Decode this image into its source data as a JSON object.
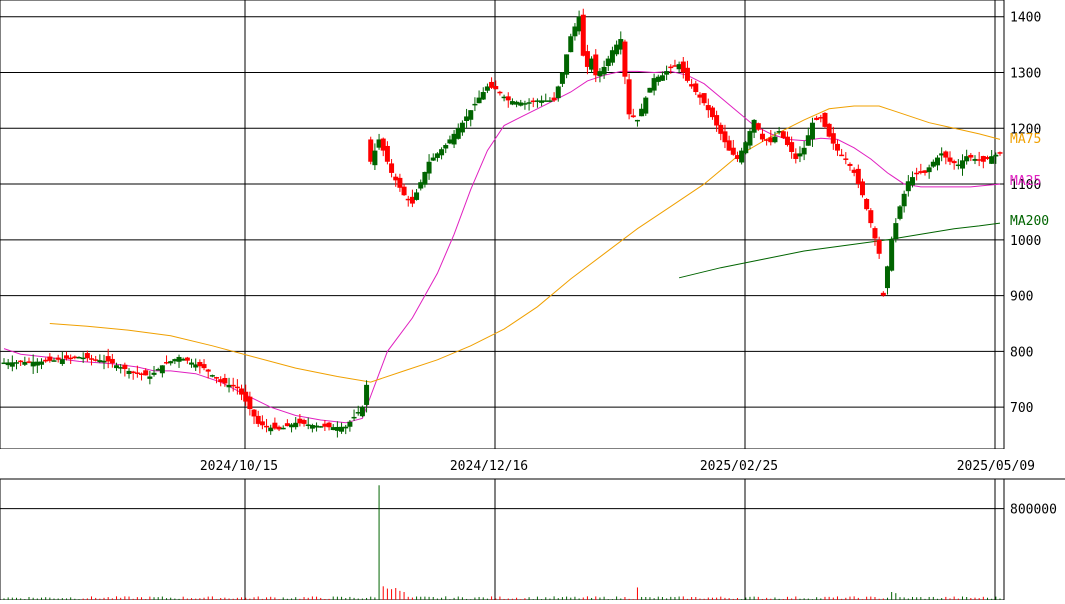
{
  "chart_data": {
    "type": "candlestick",
    "price_axis": {
      "ticks": [
        700,
        800,
        900,
        1000,
        1100,
        1200,
        1300,
        1400
      ],
      "tick_labels": [
        "700",
        "800",
        "900",
        "1000",
        "1100",
        "1200",
        "1300",
        "1400"
      ],
      "ylim": [
        625,
        1430
      ]
    },
    "x_axis": {
      "dates": [
        "2024/10/15",
        "2024/12/16",
        "2025/02/25",
        "2025/05/09"
      ]
    },
    "volume_axis": {
      "ticks": [
        800000
      ],
      "tick_labels": [
        "800000"
      ],
      "ylim": [
        0,
        1060000
      ]
    },
    "legend": [
      {
        "label": "MA75",
        "color": "#f0a000"
      },
      {
        "label": "MA25",
        "color": "#e020c0"
      },
      {
        "label": "MA200",
        "color": "#006400"
      }
    ],
    "colors": {
      "up": "#006400",
      "down": "#ff0000",
      "grid": "#000000"
    },
    "candles": {
      "count": 200,
      "segments": [
        [
          0,
          780
        ],
        [
          10,
          782
        ],
        [
          18,
          790
        ],
        [
          25,
          782
        ],
        [
          30,
          765
        ],
        [
          35,
          755
        ],
        [
          38,
          775
        ],
        [
          42,
          790
        ],
        [
          48,
          770
        ],
        [
          52,
          745
        ],
        [
          56,
          735
        ],
        [
          58,
          710
        ],
        [
          61,
          670
        ],
        [
          63,
          665
        ],
        [
          66,
          660
        ],
        [
          70,
          672
        ],
        [
          74,
          668
        ],
        [
          78,
          664
        ],
        [
          82,
          665
        ],
        [
          86,
          700
        ],
        [
          87,
          740
        ],
        [
          88,
          1140
        ],
        [
          90,
          1180
        ],
        [
          93,
          1120
        ],
        [
          96,
          1080
        ],
        [
          98,
          1065
        ],
        [
          99,
          1085
        ],
        [
          102,
          1140
        ],
        [
          106,
          1170
        ],
        [
          110,
          1210
        ],
        [
          114,
          1255
        ],
        [
          116,
          1275
        ],
        [
          118,
          1270
        ],
        [
          121,
          1250
        ],
        [
          125,
          1245
        ],
        [
          128,
          1250
        ],
        [
          132,
          1250
        ],
        [
          134,
          1300
        ],
        [
          136,
          1365
        ],
        [
          138,
          1400
        ],
        [
          139,
          1330
        ],
        [
          140,
          1310
        ],
        [
          141,
          1325
        ],
        [
          142,
          1295
        ],
        [
          144,
          1310
        ],
        [
          146,
          1340
        ],
        [
          148,
          1360
        ],
        [
          150,
          1225
        ],
        [
          152,
          1215
        ],
        [
          154,
          1255
        ],
        [
          156,
          1290
        ],
        [
          158,
          1295
        ],
        [
          160,
          1310
        ],
        [
          162,
          1315
        ],
        [
          164,
          1285
        ],
        [
          166,
          1265
        ],
        [
          168,
          1245
        ],
        [
          170,
          1220
        ],
        [
          172,
          1190
        ],
        [
          174,
          1160
        ],
        [
          176,
          1145
        ],
        [
          178,
          1175
        ],
        [
          180,
          1215
        ],
        [
          182,
          1180
        ],
        [
          184,
          1175
        ],
        [
          186,
          1195
        ],
        [
          188,
          1170
        ],
        [
          190,
          1145
        ],
        [
          192,
          1165
        ],
        [
          194,
          1210
        ],
        [
          196,
          1220
        ],
        [
          198,
          1185
        ],
        [
          200,
          1160
        ],
        [
          202,
          1145
        ],
        [
          204,
          1120
        ],
        [
          206,
          1080
        ],
        [
          208,
          1030
        ],
        [
          210,
          975
        ],
        [
          211,
          905
        ],
        [
          213,
          1000
        ],
        [
          215,
          1060
        ],
        [
          217,
          1105
        ],
        [
          219,
          1120
        ],
        [
          221,
          1120
        ],
        [
          223,
          1140
        ],
        [
          225,
          1155
        ],
        [
          227,
          1140
        ],
        [
          229,
          1135
        ],
        [
          231,
          1150
        ],
        [
          233,
          1145
        ],
        [
          235,
          1140
        ],
        [
          237,
          1150
        ],
        [
          239,
          1155
        ]
      ]
    },
    "moving_averages": {
      "MA25": [
        [
          0,
          805
        ],
        [
          4,
          795
        ],
        [
          10,
          790
        ],
        [
          18,
          782
        ],
        [
          26,
          778
        ],
        [
          32,
          772
        ],
        [
          36,
          765
        ],
        [
          40,
          765
        ],
        [
          46,
          760
        ],
        [
          52,
          745
        ],
        [
          58,
          722
        ],
        [
          64,
          700
        ],
        [
          70,
          685
        ],
        [
          76,
          677
        ],
        [
          82,
          672
        ],
        [
          86,
          680
        ],
        [
          88,
          720
        ],
        [
          92,
          800
        ],
        [
          98,
          860
        ],
        [
          104,
          940
        ],
        [
          108,
          1010
        ],
        [
          112,
          1090
        ],
        [
          116,
          1160
        ],
        [
          120,
          1205
        ],
        [
          124,
          1220
        ],
        [
          128,
          1235
        ],
        [
          132,
          1250
        ],
        [
          136,
          1265
        ],
        [
          140,
          1285
        ],
        [
          144,
          1295
        ],
        [
          148,
          1302
        ],
        [
          152,
          1302
        ],
        [
          156,
          1300
        ],
        [
          160,
          1302
        ],
        [
          164,
          1295
        ],
        [
          168,
          1280
        ],
        [
          172,
          1255
        ],
        [
          176,
          1230
        ],
        [
          180,
          1205
        ],
        [
          184,
          1190
        ],
        [
          188,
          1180
        ],
        [
          192,
          1178
        ],
        [
          196,
          1182
        ],
        [
          200,
          1180
        ],
        [
          204,
          1165
        ],
        [
          208,
          1145
        ],
        [
          212,
          1120
        ],
        [
          216,
          1100
        ],
        [
          220,
          1095
        ],
        [
          224,
          1095
        ],
        [
          228,
          1095
        ],
        [
          232,
          1095
        ],
        [
          236,
          1098
        ],
        [
          239,
          1100
        ]
      ],
      "MA75": [
        [
          11,
          850
        ],
        [
          20,
          845
        ],
        [
          30,
          838
        ],
        [
          40,
          828
        ],
        [
          50,
          810
        ],
        [
          60,
          790
        ],
        [
          70,
          770
        ],
        [
          80,
          755
        ],
        [
          88,
          745
        ],
        [
          96,
          765
        ],
        [
          104,
          785
        ],
        [
          112,
          810
        ],
        [
          120,
          840
        ],
        [
          128,
          880
        ],
        [
          136,
          930
        ],
        [
          144,
          975
        ],
        [
          152,
          1020
        ],
        [
          160,
          1060
        ],
        [
          168,
          1100
        ],
        [
          176,
          1150
        ],
        [
          184,
          1185
        ],
        [
          192,
          1215
        ],
        [
          198,
          1235
        ],
        [
          204,
          1240
        ],
        [
          210,
          1240
        ],
        [
          216,
          1225
        ],
        [
          222,
          1210
        ],
        [
          228,
          1200
        ],
        [
          234,
          1190
        ],
        [
          239,
          1180
        ]
      ],
      "MA200": [
        [
          162,
          932
        ],
        [
          172,
          950
        ],
        [
          182,
          965
        ],
        [
          192,
          980
        ],
        [
          202,
          990
        ],
        [
          212,
          1000
        ],
        [
          220,
          1010
        ],
        [
          228,
          1020
        ],
        [
          234,
          1025
        ],
        [
          239,
          1030
        ]
      ]
    },
    "volume": {
      "spike_index": 90,
      "spike_value": 1005000,
      "secondary": [
        [
          91,
          120000
        ],
        [
          92,
          100000
        ],
        [
          93,
          95000
        ],
        [
          94,
          105000
        ],
        [
          95,
          80000
        ],
        [
          96,
          70000
        ],
        [
          152,
          110000
        ],
        [
          213,
          70000
        ],
        [
          214,
          60000
        ]
      ],
      "baseline": 18000
    }
  }
}
